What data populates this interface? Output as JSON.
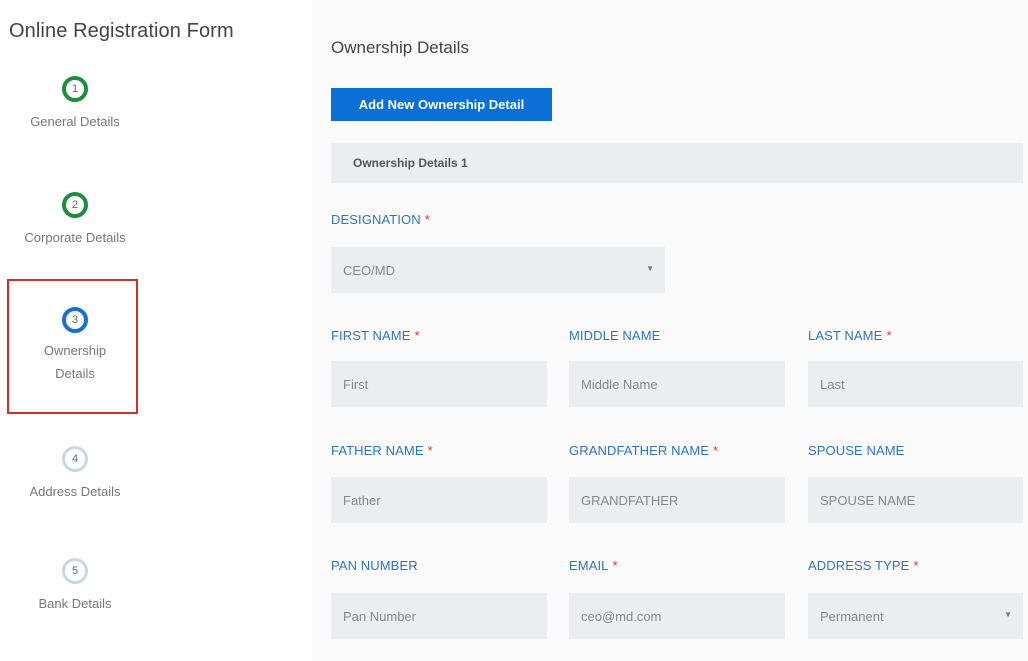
{
  "app": {
    "title": "Online Registration Form"
  },
  "steps": [
    {
      "number": "1",
      "label": "General Details",
      "state": "done"
    },
    {
      "number": "2",
      "label": "Corporate Details",
      "state": "done"
    },
    {
      "number": "3",
      "label_line1": "Ownership",
      "label_line2": "Details",
      "state": "active"
    },
    {
      "number": "4",
      "label": "Address Details",
      "state": "pending"
    },
    {
      "number": "5",
      "label": "Bank Details",
      "state": "pending"
    }
  ],
  "main": {
    "section_title": "Ownership Details",
    "add_button_label": "Add New Ownership Detail",
    "panel_title": "Ownership Details 1",
    "required_marker": "*",
    "caret_glyph": "▼",
    "fields": {
      "designation": {
        "label": "DESIGNATION",
        "value": "CEO/MD"
      },
      "first_name": {
        "label": "FIRST NAME",
        "value": "First"
      },
      "middle_name": {
        "label": "MIDDLE NAME",
        "value": "Middle Name"
      },
      "last_name": {
        "label": "LAST NAME",
        "value": "Last"
      },
      "father_name": {
        "label": "FATHER NAME",
        "value": "Father"
      },
      "grandfather_name": {
        "label": "GRANDFATHER NAME",
        "value": "GRANDFATHER"
      },
      "spouse_name": {
        "label": "SPOUSE NAME",
        "value": "SPOUSE NAME"
      },
      "pan_number": {
        "label": "PAN NUMBER",
        "value": "Pan Number"
      },
      "email": {
        "label": "EMAIL",
        "value": "ceo@md.com"
      },
      "address_type": {
        "label": "ADDRESS TYPE",
        "value": "Permanent"
      }
    }
  },
  "colors": {
    "done": "#1e8e3e",
    "active": "#1a6fd0",
    "pending": "#c9d6ea",
    "primary_button": "#0a6fd6",
    "label_blue": "#2f74c0",
    "required_red": "#e0362c",
    "highlight_box": "#d0302a"
  }
}
